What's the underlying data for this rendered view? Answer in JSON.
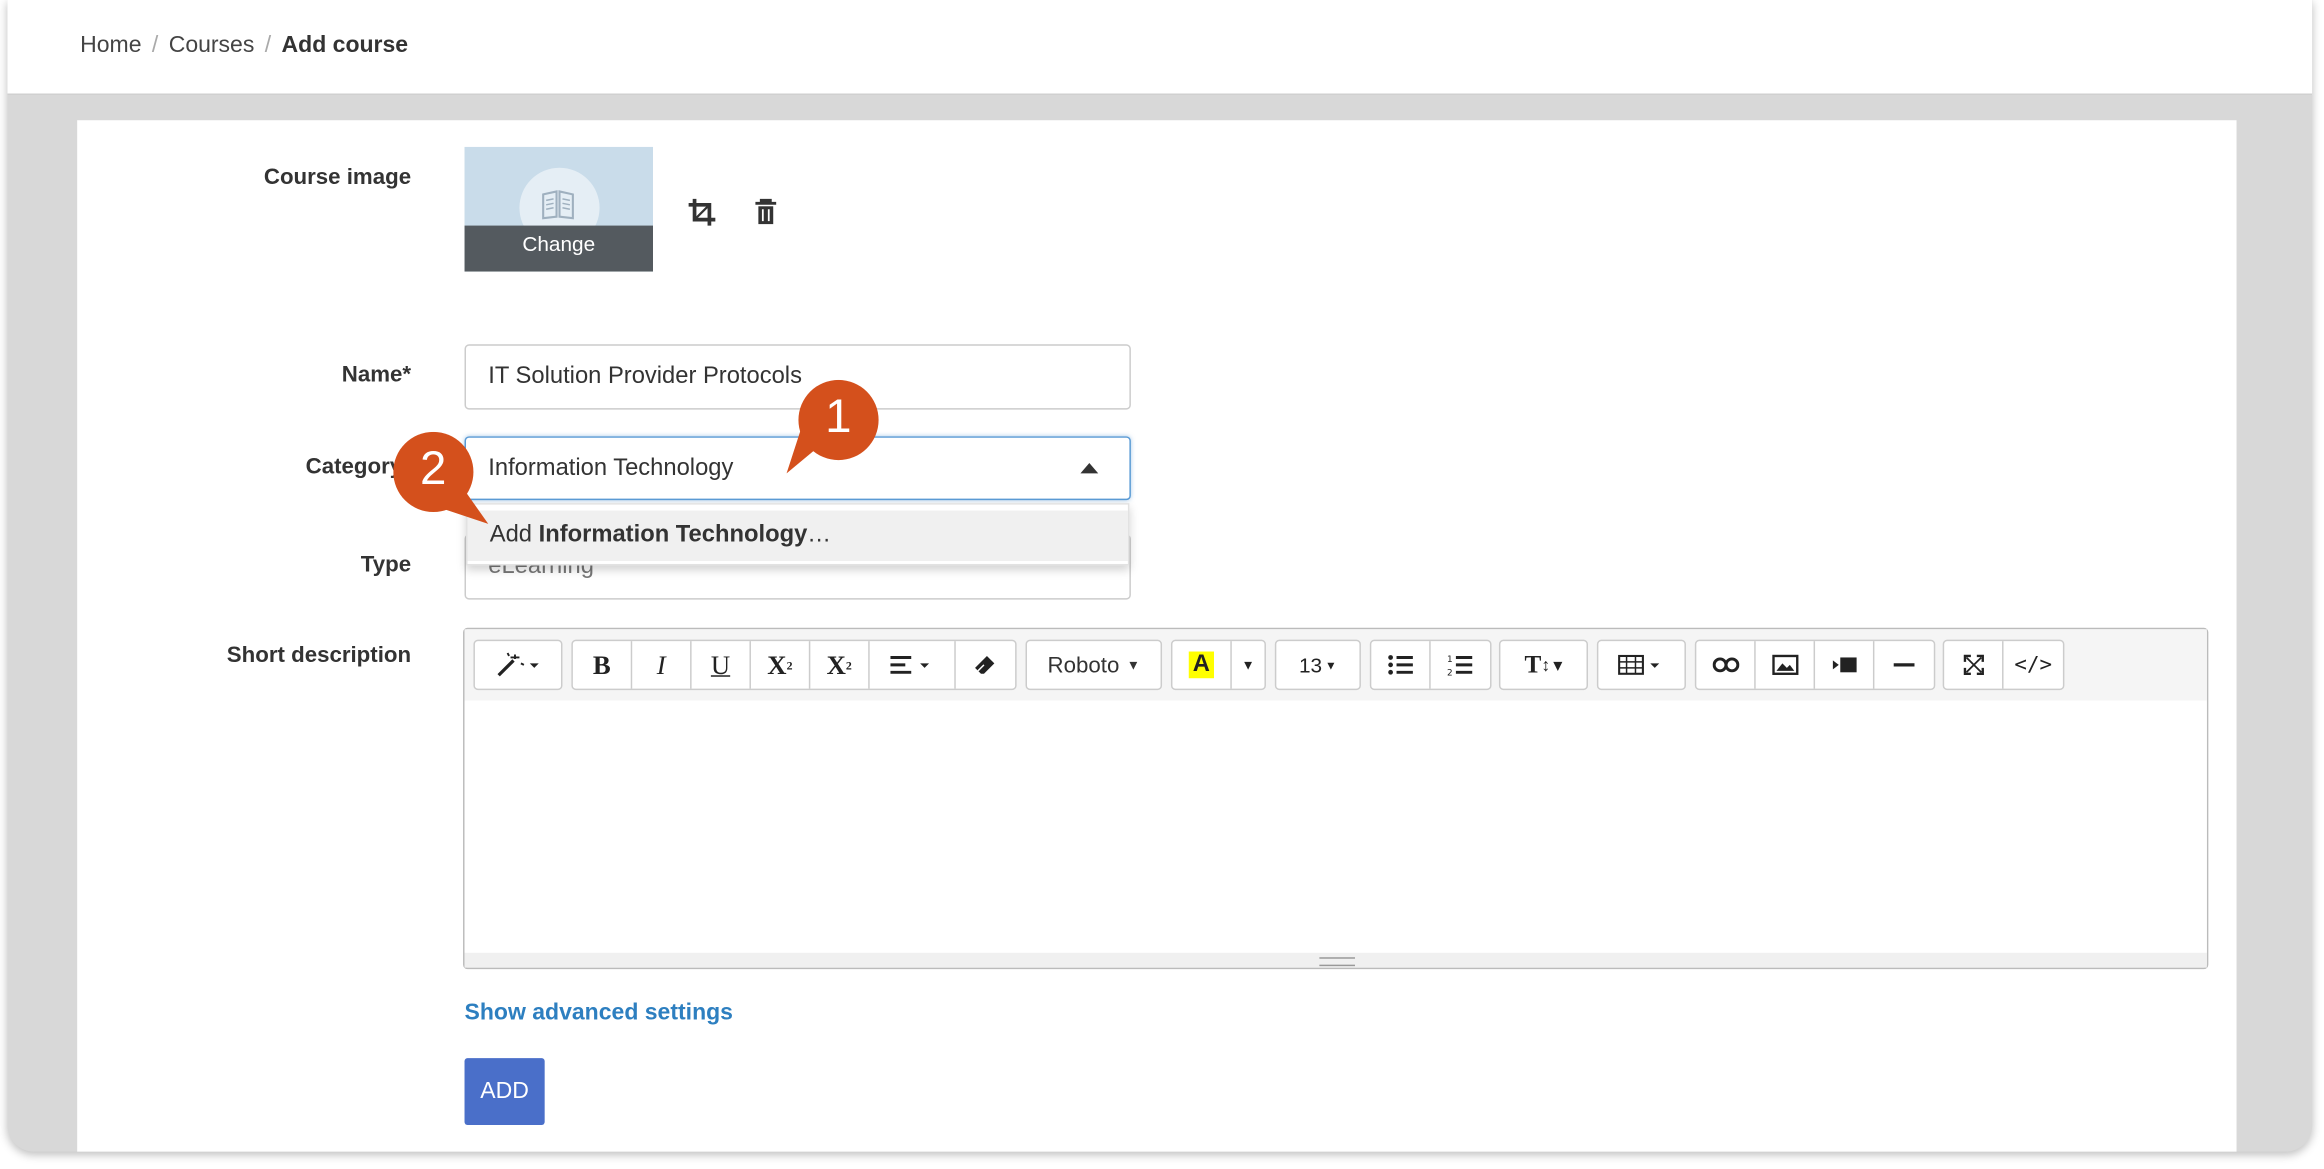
{
  "breadcrumb": {
    "home": "Home",
    "courses": "Courses",
    "current": "Add course"
  },
  "form": {
    "course_image_label": "Course image",
    "change_label": "Change",
    "name_label": "Name*",
    "name_value": "IT Solution Provider Protocols",
    "category_label": "Category",
    "category_value": "Information Technology",
    "type_label": "Type",
    "type_value": "eLearning",
    "short_description_label": "Short description",
    "advanced_link": "Show advanced settings",
    "add_button": "ADD"
  },
  "dropdown": {
    "add_prefix": "Add ",
    "add_value": "Information Technology",
    "add_suffix": "…"
  },
  "editor": {
    "font_name": "Roboto",
    "font_size": "13"
  },
  "callouts": [
    "1",
    "2"
  ],
  "colors": {
    "accent": "#4a6fc9",
    "link": "#2d7fc0",
    "callout": "#d4501c",
    "highlight": "#ffff00"
  }
}
